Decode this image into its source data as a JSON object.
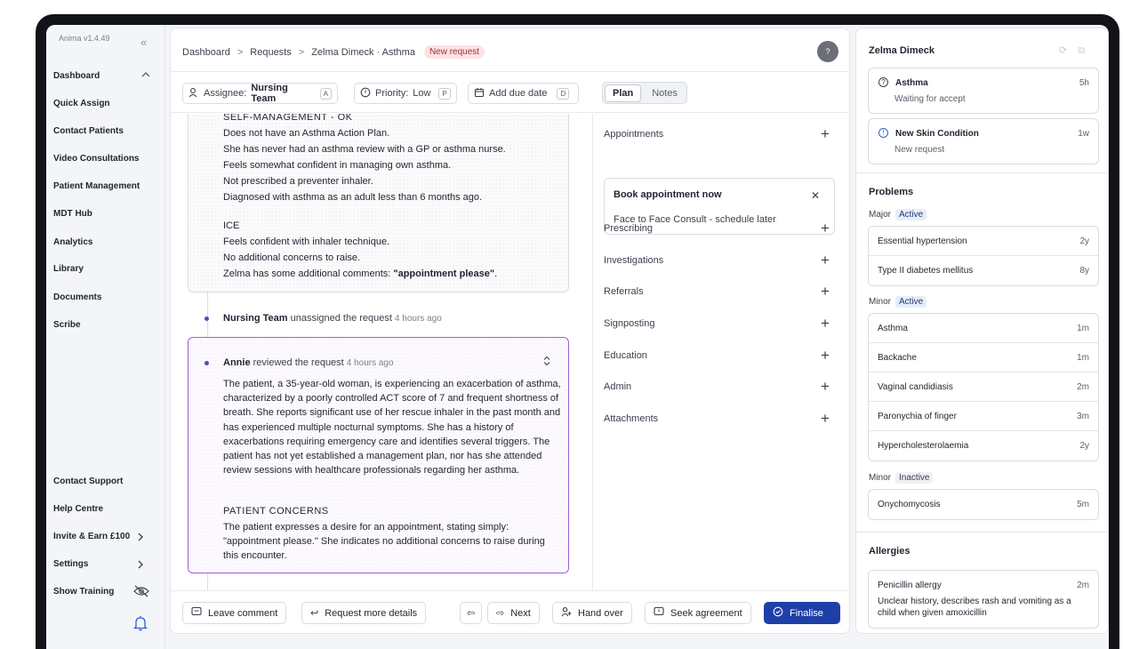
{
  "app": {
    "version": "Anima v1.4.49"
  },
  "sidebar": {
    "items": [
      {
        "label": "Dashboard"
      },
      {
        "label": "Quick Assign"
      },
      {
        "label": "Contact Patients"
      },
      {
        "label": "Video Consultations"
      },
      {
        "label": "Patient Management"
      },
      {
        "label": "MDT Hub"
      },
      {
        "label": "Analytics"
      },
      {
        "label": "Library"
      },
      {
        "label": "Documents"
      },
      {
        "label": "Scribe"
      }
    ],
    "bottom_items": [
      {
        "label": "Contact Support"
      },
      {
        "label": "Help Centre"
      },
      {
        "label": "Invite & Earn £100"
      },
      {
        "label": "Settings"
      },
      {
        "label": "Show Training"
      }
    ]
  },
  "header": {
    "breadcrumbs": [
      "Dashboard",
      "Requests",
      "Zelma Dimeck · Asthma"
    ],
    "badge": "New request",
    "help": "?"
  },
  "toolbar": {
    "assignee_label": "Assignee:",
    "assignee_value": "Nursing Team",
    "assignee_key": "A",
    "priority_label": "Priority:",
    "priority_value": "Low",
    "priority_key": "P",
    "due_label": "Add due date",
    "due_key": "D"
  },
  "tabs": [
    "Plan",
    "Notes"
  ],
  "timeline": {
    "card1_lines": [
      "SELF-MANAGEMENT - OK",
      "Does not have an Asthma Action Plan.",
      "She has never had an asthma review with a GP or asthma nurse.",
      "Feels somewhat confident in managing own asthma.",
      "Not prescribed a preventer inhaler.",
      "Diagnosed with asthma as an adult less than 6 months ago."
    ],
    "ice_heading": "ICE",
    "ice_lines": [
      "Feels confident with inhaler technique.",
      "No additional concerns to raise."
    ],
    "comment_prefix": "Zelma has some additional comments: ",
    "comment_quote": "\"appointment please\"",
    "comment_suffix": ".",
    "event1": {
      "actor": "Nursing Team",
      "action": " unassigned the request",
      "time": "4 hours ago"
    },
    "event2": {
      "actor": "Annie",
      "action": " reviewed the request",
      "time": "4 hours ago"
    },
    "review_paragraph": "The patient, a 35-year-old woman, is experiencing an exacerbation of asthma, characterized by a poorly controlled ACT score of 7 and frequent shortness of breath. She reports significant use of her rescue inhaler in the past month and has experienced multiple nocturnal symptoms. She has a history of exacerbations requiring emergency care and identifies several triggers. The patient has not yet established a management plan, nor has she attended review sessions with healthcare professionals regarding her asthma.",
    "concerns_heading": "PATIENT CONCERNS",
    "concerns_paragraph": "The patient expresses a desire for an appointment, stating simply: \"appointment please.\" She indicates no additional concerns to raise during this encounter."
  },
  "plan": {
    "sections": [
      "Appointments",
      "Prescribing",
      "Investigations",
      "Referrals",
      "Signposting",
      "Education",
      "Admin",
      "Attachments"
    ],
    "appointment_card": {
      "title": "Book appointment now",
      "subtitle": "Face to Face Consult - schedule later"
    }
  },
  "footer": {
    "leave_comment": "Leave comment",
    "request_more": "Request more details",
    "next": "Next",
    "hand_over": "Hand over",
    "seek_agreement": "Seek agreement",
    "finalise": "Finalise"
  },
  "patient": {
    "name": "Zelma Dimeck",
    "requests": [
      {
        "title": "Asthma",
        "status": "Waiting for accept",
        "age": "5h"
      },
      {
        "title": "New Skin Condition",
        "status": "New request",
        "age": "1w"
      }
    ],
    "problems_heading": "Problems",
    "major_label": "Major",
    "major_status": "Active",
    "major": [
      {
        "name": "Essential hypertension",
        "age": "2y"
      },
      {
        "name": "Type II diabetes mellitus",
        "age": "8y"
      }
    ],
    "minor_active_label": "Minor",
    "minor_active_status": "Active",
    "minor_active": [
      {
        "name": "Asthma",
        "age": "1m"
      },
      {
        "name": "Backache",
        "age": "1m"
      },
      {
        "name": "Vaginal candidiasis",
        "age": "2m"
      },
      {
        "name": "Paronychia of finger",
        "age": "3m"
      },
      {
        "name": "Hypercholesterolaemia",
        "age": "2y"
      }
    ],
    "minor_inactive_label": "Minor",
    "minor_inactive_status": "Inactive",
    "minor_inactive": [
      {
        "name": "Onychomycosis",
        "age": "5m"
      }
    ],
    "allergies_heading": "Allergies",
    "allergy": {
      "name": "Penicillin allergy",
      "age": "2m",
      "description": "Unclear history, describes rash and vomiting as a child when given amoxicillin"
    }
  },
  "colors": {
    "accent": "#1f3fa8",
    "highlight_border": "#9b5fd6",
    "badge_bg": "#fbe3e3"
  }
}
